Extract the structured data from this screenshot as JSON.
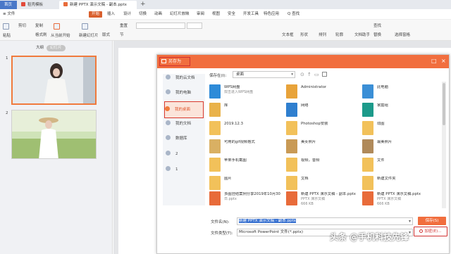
{
  "tabs": {
    "home": "首页",
    "template": "稻壳模板",
    "doc": "新建 PPTX 演示文稿 - 副本.pptx",
    "new_tab": "+"
  },
  "menu": {
    "file": "≡ 文件",
    "items": [
      "开始",
      "插入",
      "设计",
      "切换",
      "动画",
      "幻灯片放映",
      "审阅",
      "视图",
      "安全",
      "开发工具",
      "特色应用",
      "Q 查找"
    ]
  },
  "toolbar": {
    "paste": "粘贴",
    "cut": "剪切",
    "copy": "复制",
    "format": "格式刷",
    "play": "从当前开始",
    "new_slide": "新建幻灯片",
    "layout": "版式",
    "section": "节",
    "reset": "重置",
    "textbox": "文本框",
    "shapes": "形状",
    "arrange": "排列",
    "outline": "轮廓",
    "arrange_tool": "文档助手",
    "find": "查找",
    "replace": "替换",
    "select": "选择窗格"
  },
  "sidepanel": {
    "view_outline": "大纲",
    "view_slides": "幻灯片",
    "slide_numbers": [
      "1",
      "2"
    ]
  },
  "dialog": {
    "title": "另存为",
    "save_in_label": "保存在(I):",
    "save_in_value": "桌面",
    "places": [
      "我的云文档",
      "我的电脑",
      "我的桌面",
      "我的文档",
      "数据库",
      "2",
      "1"
    ],
    "files": [
      {
        "name": "WPS网盘",
        "sub": "双击进入WPS网盘",
        "sub2": "",
        "color": "#2e8bd8"
      },
      {
        "name": "Administrator",
        "sub": "",
        "sub2": "",
        "color": "#e8a33a"
      },
      {
        "name": "此电脑",
        "sub": "",
        "sub2": "",
        "color": "#3b8fd6"
      },
      {
        "name": "库",
        "sub": "",
        "sub2": "",
        "color": "#e9b24a"
      },
      {
        "name": "网络",
        "sub": "",
        "sub2": "",
        "color": "#2f7fcf"
      },
      {
        "name": "家庭组",
        "sub": "",
        "sub2": "",
        "color": "#1c9a8a"
      },
      {
        "name": "2019.12.3",
        "sub": "",
        "sub2": "",
        "color": "#f2c15a"
      },
      {
        "name": "Photoshop安装",
        "sub": "",
        "sub2": "",
        "color": "#f2c15a"
      },
      {
        "name": "动图",
        "sub": "",
        "sub2": "",
        "color": "#f2c15a"
      },
      {
        "name": "可用的gif视频格式",
        "sub": "",
        "sub2": "",
        "color": "#d9b063"
      },
      {
        "name": "美女照片",
        "sub": "",
        "sub2": "",
        "color": "#c99a55"
      },
      {
        "name": "最美照片",
        "sub": "",
        "sub2": "",
        "color": "#b08a5a"
      },
      {
        "name": "苹果手机截图",
        "sub": "",
        "sub2": "",
        "color": "#f2c15a"
      },
      {
        "name": "视频，音频",
        "sub": "",
        "sub2": "",
        "color": "#f2c15a"
      },
      {
        "name": "文件",
        "sub": "",
        "sub2": "",
        "color": "#f2c15a"
      },
      {
        "name": "图片",
        "sub": "",
        "sub2": "",
        "color": "#f2c15a"
      },
      {
        "name": "文档",
        "sub": "",
        "sub2": "",
        "color": "#f2c15a"
      },
      {
        "name": "新建文件夹",
        "sub": "",
        "sub2": "",
        "color": "#f2c15a"
      },
      {
        "name": "多图挂结案例分享2019年10月30",
        "sub": "日.pptx",
        "sub2": "",
        "color": "#e86b3a"
      },
      {
        "name": "新建 PPTX 演示文稿 - 副本.pptx",
        "sub": "PPTX 演示文稿",
        "sub2": "666 KB",
        "color": "#e86b3a"
      },
      {
        "name": "新建 PPTX 演示文稿.pptx",
        "sub": "PPTX 演示文稿",
        "sub2": "666 KB",
        "color": "#e86b3a"
      }
    ],
    "filename_label": "文件名(N):",
    "filename_value": "新建 PPTX 演示文稿 - 副本.pptx",
    "filetype_label": "文件类型(T):",
    "filetype_value": "Microsoft PowerPoint 文件(*.pptx)",
    "save_button": "保存(S)",
    "encrypt_button": "加密(E)..."
  },
  "watermark": "头条 @手机科技先锋"
}
